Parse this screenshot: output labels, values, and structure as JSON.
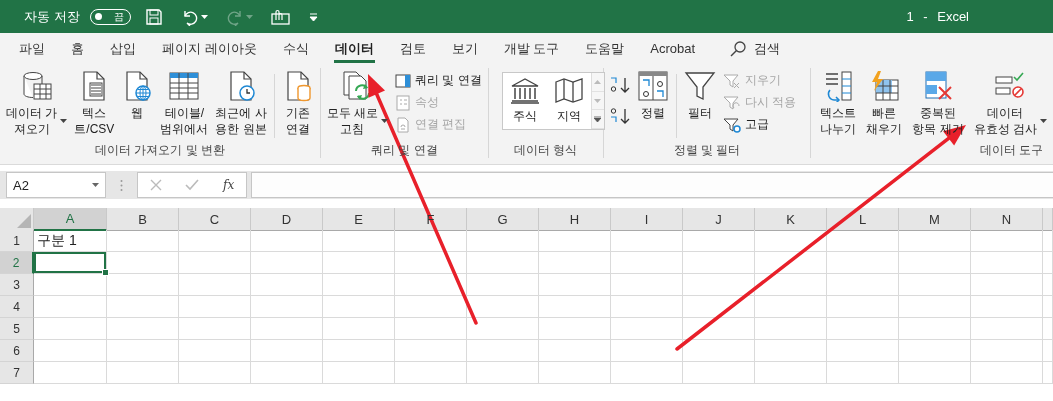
{
  "title_bar": {
    "autosave_label": "자동 저장",
    "autosave_toggle": {
      "label": "끔",
      "on": false
    },
    "quick_access": [
      {
        "kind": "save",
        "disabled": false
      },
      {
        "kind": "undo",
        "disabled": false
      },
      {
        "kind": "redo",
        "disabled": true
      },
      {
        "kind": "touch",
        "disabled": false
      },
      {
        "kind": "customize",
        "disabled": false
      }
    ],
    "title": "1 - Excel"
  },
  "tabs": [
    {
      "label": "파일",
      "selected": false
    },
    {
      "label": "홈",
      "selected": false
    },
    {
      "label": "삽입",
      "selected": false
    },
    {
      "label": "페이지 레이아웃",
      "selected": false
    },
    {
      "label": "수식",
      "selected": false
    },
    {
      "label": "데이터",
      "selected": true
    },
    {
      "label": "검토",
      "selected": false
    },
    {
      "label": "보기",
      "selected": false
    },
    {
      "label": "개발 도구",
      "selected": false
    },
    {
      "label": "도움말",
      "selected": false
    },
    {
      "label": "Acrobat",
      "selected": false
    }
  ],
  "search": {
    "label": "검색"
  },
  "ribbon_groups": [
    {
      "label": "데이터 가져오기 및 변환",
      "items": [
        {
          "kind": "large",
          "lines": [
            "데이터 가",
            "져오기"
          ],
          "dropdown": true,
          "disabled": false
        },
        {
          "kind": "large",
          "lines": [
            "텍스",
            "트/CSV"
          ],
          "dropdown": false,
          "disabled": false
        },
        {
          "kind": "large",
          "lines": [
            "웹"
          ],
          "dropdown": false,
          "disabled": false
        },
        {
          "kind": "large",
          "lines": [
            "테이블/",
            "범위에서"
          ],
          "dropdown": false,
          "disabled": false
        },
        {
          "kind": "large",
          "lines": [
            "최근에 사",
            "용한 원본"
          ],
          "dropdown": false,
          "disabled": false
        },
        {
          "kind": "separator"
        },
        {
          "kind": "large",
          "lines": [
            "기존",
            "연결"
          ],
          "dropdown": false,
          "disabled": false
        }
      ]
    },
    {
      "label": "쿼리 및 연결",
      "items": [
        {
          "kind": "large",
          "lines": [
            "모두 새로",
            "고침"
          ],
          "dropdown": true,
          "disabled": false
        },
        {
          "kind": "small_stack",
          "buttons": [
            {
              "label": "쿼리 및 연결",
              "disabled": false
            },
            {
              "label": "속성",
              "disabled": true
            },
            {
              "label": "연결 편집",
              "disabled": true
            }
          ]
        }
      ]
    },
    {
      "label": "데이터 형식",
      "items": [
        {
          "kind": "gallery",
          "options": [
            {
              "label": "주식"
            },
            {
              "label": "지역"
            }
          ]
        }
      ]
    },
    {
      "label": "정렬 및 필터",
      "items": [
        {
          "kind": "icon_stack"
        },
        {
          "kind": "large",
          "lines": [
            "정렬"
          ],
          "dropdown": false,
          "disabled": false
        },
        {
          "kind": "separator"
        },
        {
          "kind": "large",
          "lines": [
            "필터"
          ],
          "dropdown": false,
          "disabled": false
        },
        {
          "kind": "small_stack",
          "buttons": [
            {
              "label": "지우기",
              "disabled": true
            },
            {
              "label": "다시 적용",
              "disabled": true
            },
            {
              "label": "고급",
              "disabled": false
            }
          ]
        }
      ]
    },
    {
      "label": "데이터 도구",
      "items": [
        {
          "kind": "large",
          "lines": [
            "텍스트",
            "나누기"
          ],
          "dropdown": false,
          "disabled": false
        },
        {
          "kind": "large",
          "lines": [
            "빠른",
            "채우기"
          ],
          "dropdown": false,
          "disabled": false
        },
        {
          "kind": "large",
          "lines": [
            "중복된",
            "항목 제거"
          ],
          "dropdown": false,
          "disabled": false
        },
        {
          "kind": "large",
          "lines": [
            "데이터",
            "유효성 검사"
          ],
          "dropdown": true,
          "disabled": false
        }
      ]
    }
  ],
  "formula_bar": {
    "name_box": "A2",
    "function_label": "fx"
  },
  "columns": [
    {
      "label": "A",
      "selected": true
    },
    {
      "label": "B",
      "selected": false
    },
    {
      "label": "C",
      "selected": false
    },
    {
      "label": "D",
      "selected": false
    },
    {
      "label": "E",
      "selected": false
    },
    {
      "label": "F",
      "selected": false
    },
    {
      "label": "G",
      "selected": false
    },
    {
      "label": "H",
      "selected": false
    },
    {
      "label": "I",
      "selected": false
    },
    {
      "label": "J",
      "selected": false
    },
    {
      "label": "K",
      "selected": false
    },
    {
      "label": "L",
      "selected": false
    },
    {
      "label": "M",
      "selected": false
    },
    {
      "label": "N",
      "selected": false
    }
  ],
  "rows": [
    {
      "label": "1",
      "selected": false,
      "cells": [
        {
          "text": "구분 1",
          "selected": false
        }
      ]
    },
    {
      "label": "2",
      "selected": true,
      "cells": [
        {
          "selected": true
        }
      ]
    },
    {
      "label": "3",
      "selected": false
    },
    {
      "label": "4",
      "selected": false
    },
    {
      "label": "5",
      "selected": false
    },
    {
      "label": "6",
      "selected": false
    },
    {
      "label": "7",
      "selected": false
    }
  ],
  "annotations": [
    {
      "kind": "arrow"
    },
    {
      "kind": "arrow"
    }
  ]
}
